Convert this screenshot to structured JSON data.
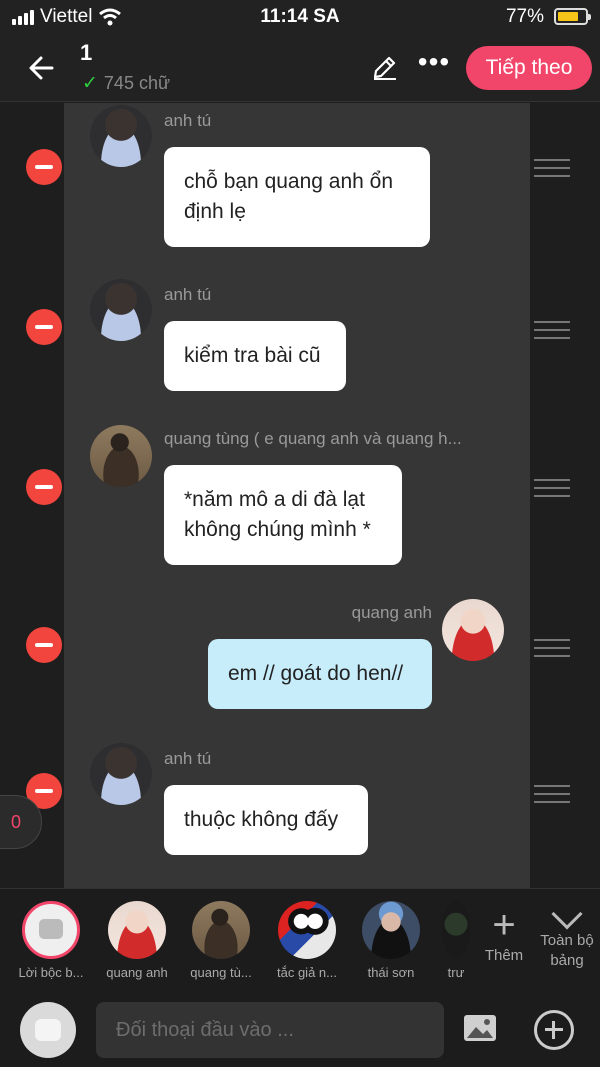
{
  "status_bar": {
    "carrier": "Viettel",
    "time": "11:14 SA",
    "battery": "77%",
    "battery_level": 0.77
  },
  "header": {
    "title": "1",
    "word_count": "745 chữ",
    "next_label": "Tiếp theo"
  },
  "messages": [
    {
      "name": "anh tú",
      "text": "chỗ bạn quang anh ổn định lẹ"
    },
    {
      "name": "anh tú",
      "text": "kiểm tra bài cũ"
    },
    {
      "name": "quang tùng ( e quang anh và quang h...",
      "text": "*năm mô a di đà lạt không chúng mình *"
    },
    {
      "name": "quang anh",
      "text": "em // goát do hen//"
    },
    {
      "name": "anh tú",
      "text": "thuộc không đấy"
    }
  ],
  "side_counter": "0",
  "characters": [
    {
      "label": "Lời bộc b..."
    },
    {
      "label": "quang anh"
    },
    {
      "label": "quang tù..."
    },
    {
      "label": "tắc giả n..."
    },
    {
      "label": "thái sơn"
    },
    {
      "label": "trư"
    }
  ],
  "add_character_label": "Thêm",
  "table_label": "Toàn bộ bảng",
  "input": {
    "placeholder": "Đối thoại đầu vào ..."
  }
}
